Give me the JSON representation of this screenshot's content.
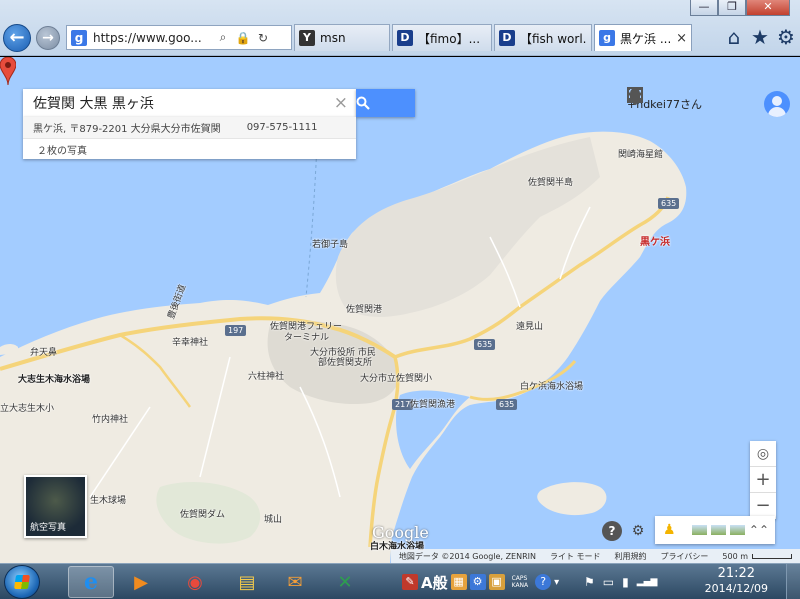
{
  "window": {
    "controls": [
      "—",
      "❐",
      "✕"
    ]
  },
  "browser": {
    "url": "https://www.goo...",
    "nav": {
      "back": "←",
      "forward": "→"
    },
    "address_icons": [
      "⌕",
      "🔒",
      "↻"
    ],
    "tabs": [
      {
        "label": "msn",
        "icon": "msn-icon",
        "icon_text": "Y",
        "color": "#333333",
        "active": false
      },
      {
        "label": "【fimo】...",
        "icon": "fimo-icon",
        "icon_text": "D",
        "color": "#1a3e8c",
        "active": false
      },
      {
        "label": "【fish worl...",
        "icon": "fishworld-icon",
        "icon_text": "D",
        "color": "#1a3e8c",
        "active": false
      },
      {
        "label": "黒ケ浜 ...",
        "icon": "google-icon",
        "icon_text": "g",
        "color": "#3b78e7",
        "active": true
      }
    ],
    "toolbar_icons": [
      "⌂",
      "★",
      "⚙"
    ]
  },
  "maps": {
    "search": {
      "query": "佐賀関 大黒 黒ヶ浜",
      "clear": "×",
      "button_icon": "🔍"
    },
    "suggestion": {
      "address": "黒ケ浜, 〒879-2201 大分県大分市佐賀関",
      "phone": "097-575-1111",
      "photos": "２枚の写真"
    },
    "account": {
      "name": "+hdkei77さん",
      "apps_icon": "⋮⋮⋮",
      "bell_icon": "🔔",
      "add_icon": "⊞"
    },
    "marker": {
      "label": "黒ケ浜"
    },
    "zoom": {
      "locate": "◎",
      "in": "+",
      "out": "−"
    },
    "satellite_label": "航空写真",
    "help": "?",
    "settings": "⚙",
    "pegman": "♟",
    "expand": "⌃⌃",
    "google_logo": "Google",
    "attribution": [
      "地図データ ©2014 Google, ZENRIN",
      "ライト モード",
      "利用規約",
      "プライバシー"
    ],
    "scale": "500 m",
    "places": [
      {
        "id": "sekisaki-lighthouse",
        "text": "関崎海星館"
      },
      {
        "id": "sagaseki-peninsula",
        "text": "佐賀関半島"
      },
      {
        "id": "wakamikoshima",
        "text": "若御子島"
      },
      {
        "id": "sagaseki-port",
        "text": "佐賀関港"
      },
      {
        "id": "ferry-terminal-1",
        "text": "佐賀関港フェリー"
      },
      {
        "id": "ferry-terminal-2",
        "text": "ターミナル"
      },
      {
        "id": "route-197",
        "text": "197"
      },
      {
        "id": "route-635-a",
        "text": "635"
      },
      {
        "id": "route-635-b",
        "text": "635"
      },
      {
        "id": "route-635-c",
        "text": "635"
      },
      {
        "id": "route-217",
        "text": "217"
      },
      {
        "id": "hayasui",
        "text": "豊後街道"
      },
      {
        "id": "kosai-shrine",
        "text": "辛幸神社"
      },
      {
        "id": "city-office-1",
        "text": "大分市役所 市民"
      },
      {
        "id": "city-office-2",
        "text": "部佐賀関支所"
      },
      {
        "id": "tohmiyama",
        "text": "遠見山"
      },
      {
        "id": "benten",
        "text": "弁天鼻"
      },
      {
        "id": "rokucha",
        "text": "六柱神社"
      },
      {
        "id": "elementary",
        "text": "大分市立佐賀関小"
      },
      {
        "id": "shirogahama",
        "text": "白ケ浜海水浴場"
      },
      {
        "id": "oshio-beach",
        "text": "大志生木海水浴場"
      },
      {
        "id": "oshio-school",
        "text": "立大志生木小"
      },
      {
        "id": "takeuchi",
        "text": "竹内神社"
      },
      {
        "id": "fishing-port",
        "text": "佐賀関漁港"
      },
      {
        "id": "kuroki",
        "text": "生木球場"
      },
      {
        "id": "dam",
        "text": "佐賀関ダム"
      },
      {
        "id": "shiroyama",
        "text": "城山"
      },
      {
        "id": "shiraki-beach",
        "text": "白木海水浴場"
      }
    ]
  },
  "taskbar": {
    "apps": [
      {
        "id": "ie",
        "icon": "e",
        "color": "#1f8ef0",
        "active": true
      },
      {
        "id": "media",
        "icon": "▶",
        "color": "#f08b1f",
        "active": false
      },
      {
        "id": "chrome",
        "icon": "◉",
        "color": "#e84a3c",
        "active": false
      },
      {
        "id": "explorer",
        "icon": "▤",
        "color": "#f2c94c",
        "active": false
      },
      {
        "id": "outlook",
        "icon": "✉",
        "color": "#f29d38",
        "active": false
      },
      {
        "id": "excel",
        "icon": "✕",
        "color": "#2e9e4f",
        "active": false
      }
    ],
    "ime": "A般",
    "caps": "CAPS\nKANA",
    "tray_icons": [
      "⚑",
      "▭",
      "▮",
      "▂▄▆"
    ],
    "time": "21:22",
    "date": "2014/12/09"
  }
}
